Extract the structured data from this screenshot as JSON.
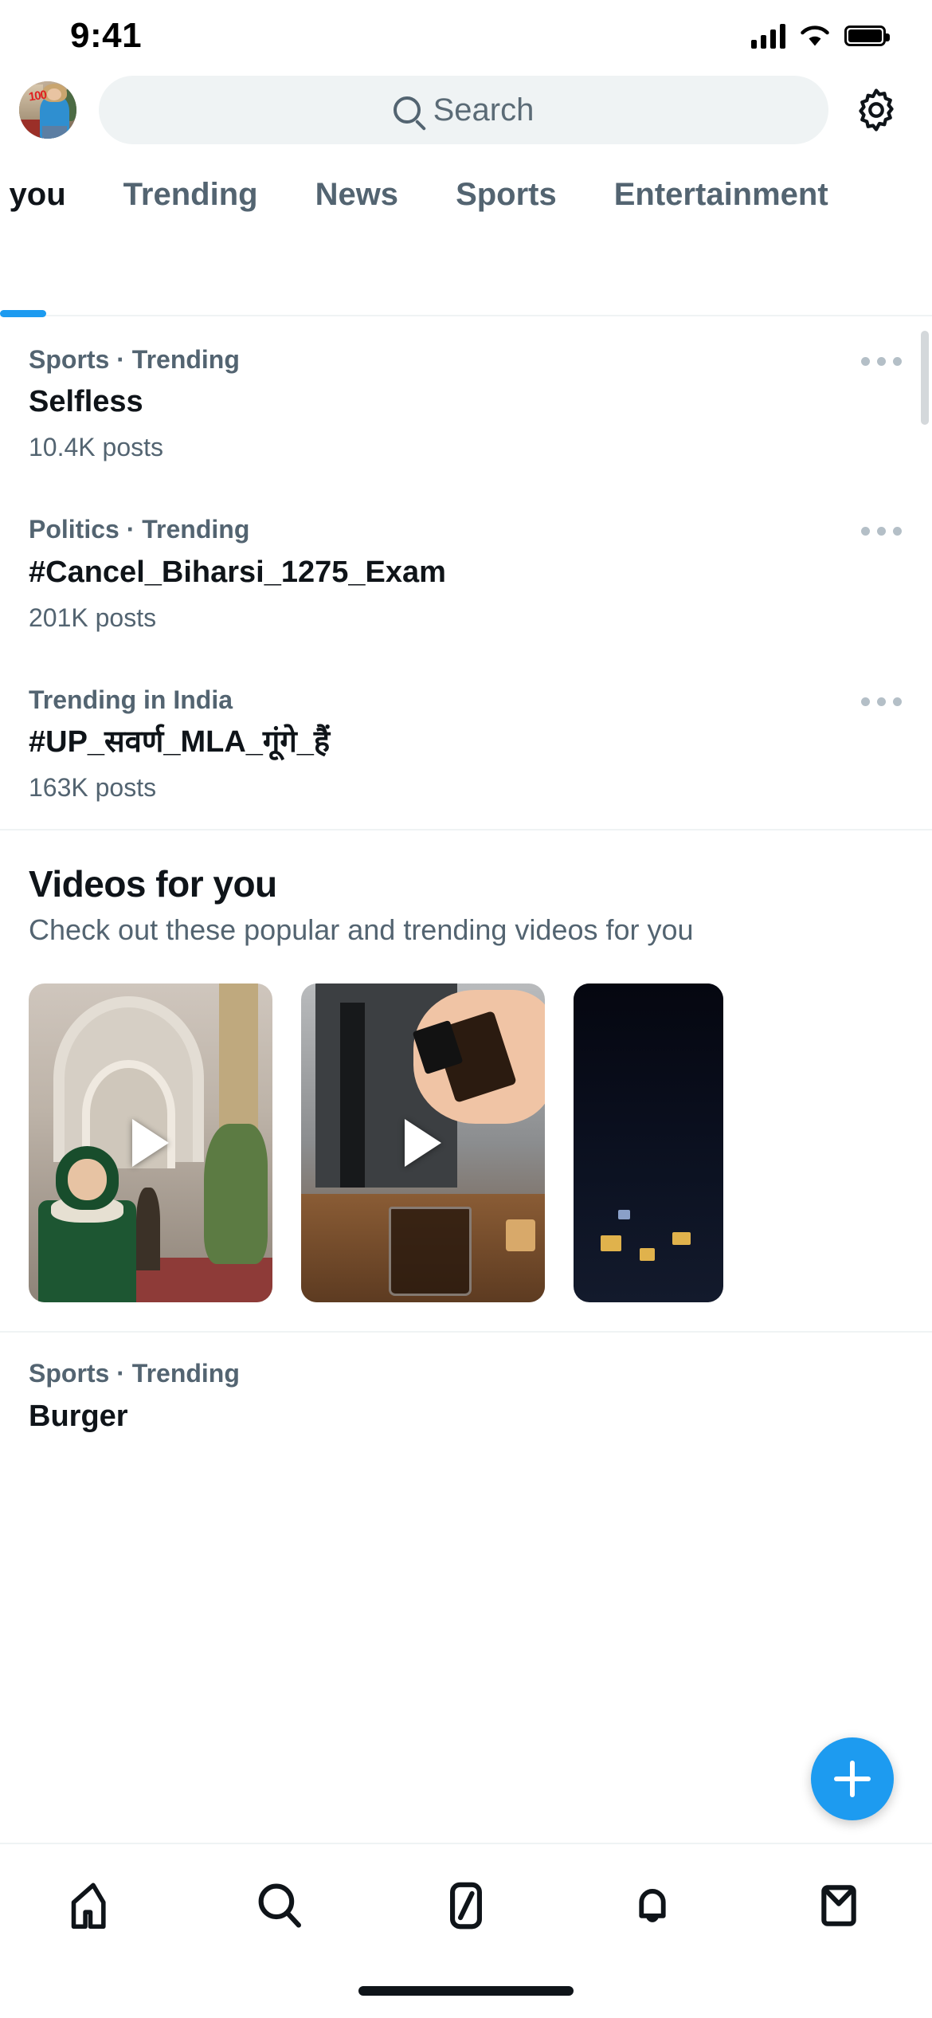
{
  "status_bar": {
    "time": "9:41",
    "cellular_icon": "signal-bars-icon",
    "wifi_icon": "wifi-icon",
    "battery_icon": "battery-full-icon"
  },
  "header": {
    "avatar_name": "profile-avatar",
    "avatar_badge": "100",
    "search_placeholder": "Search",
    "search_value": "",
    "settings_icon": "gear-icon"
  },
  "tabs": [
    {
      "label": "For you",
      "selected": true
    },
    {
      "label": "Trending",
      "selected": false
    },
    {
      "label": "News",
      "selected": false
    },
    {
      "label": "Sports",
      "selected": false
    },
    {
      "label": "Entertainment",
      "selected": false
    }
  ],
  "trends": [
    {
      "category": "Sports · Trending",
      "title": "Selfless",
      "count": "10.4K posts",
      "more_icon": "more-horizontal-icon"
    },
    {
      "category": "Politics · Trending",
      "title": "#Cancel_Biharsi_1275_Exam",
      "count": "201K posts",
      "more_icon": "more-horizontal-icon"
    },
    {
      "category": "Trending in India",
      "title": "#UP_सवर्ण_MLA_गूंगे_हैं",
      "count": "163K posts",
      "more_icon": "more-horizontal-icon"
    }
  ],
  "videos_section": {
    "title": "Videos for you",
    "subtitle": "Check out these popular and trending videos for you",
    "cards": [
      {
        "name": "video-thumbnail-hallway-kid",
        "play_icon": "play-icon"
      },
      {
        "name": "video-thumbnail-coffee-pour",
        "play_icon": "play-icon"
      },
      {
        "name": "video-thumbnail-night-city",
        "play_icon": "play-icon"
      }
    ]
  },
  "bottom_trend": {
    "category": "Sports · Trending",
    "title": "Burger"
  },
  "compose_fab": {
    "icon": "plus-icon",
    "label": ""
  },
  "bottom_nav": [
    {
      "name": "nav-home",
      "icon": "home-icon",
      "selected": false
    },
    {
      "name": "nav-search",
      "icon": "search-icon",
      "selected": true
    },
    {
      "name": "nav-grok",
      "icon": "grok-slash-icon",
      "selected": false
    },
    {
      "name": "nav-notifications",
      "icon": "bell-icon",
      "selected": false
    },
    {
      "name": "nav-messages",
      "icon": "envelope-icon",
      "selected": false
    }
  ],
  "colors": {
    "accent": "#1d9bf0",
    "text_primary": "#0f1419",
    "text_secondary": "#536471",
    "divider": "#eff3f4",
    "search_bg": "#eff3f4"
  }
}
